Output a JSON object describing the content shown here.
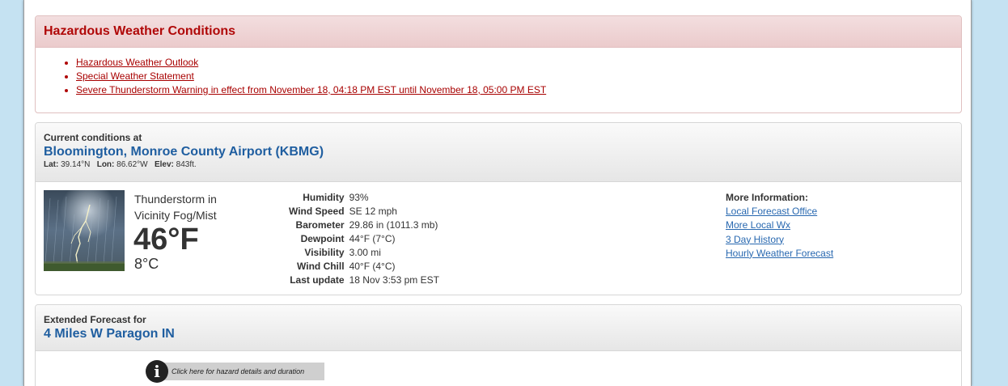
{
  "hazards": {
    "title": "Hazardous Weather Conditions",
    "items": [
      "Hazardous Weather Outlook",
      "Special Weather Statement",
      "Severe Thunderstorm Warning in effect from November 18, 04:18 PM EST until November 18, 05:00 PM EST"
    ]
  },
  "current": {
    "heading": "Current conditions at",
    "location": "Bloomington, Monroe County Airport (KBMG)",
    "lat_label": "Lat:",
    "lat": "39.14°N",
    "lon_label": "Lon:",
    "lon": "86.62°W",
    "elev_label": "Elev:",
    "elev": "843ft.",
    "condition": "Thunderstorm in Vicinity Fog/Mist",
    "temp_f": "46°F",
    "temp_c": "8°C",
    "image_icon": "thunderstorm-lightning-icon",
    "details": [
      {
        "label": "Humidity",
        "value": "93%"
      },
      {
        "label": "Wind Speed",
        "value": "SE 12 mph"
      },
      {
        "label": "Barometer",
        "value": "29.86 in (1011.3 mb)"
      },
      {
        "label": "Dewpoint",
        "value": "44°F (7°C)"
      },
      {
        "label": "Visibility",
        "value": "3.00 mi"
      },
      {
        "label": "Wind Chill",
        "value": "40°F (4°C)"
      },
      {
        "label": "Last update",
        "value": "18 Nov 3:53 pm EST"
      }
    ],
    "more_title": "More Information:",
    "more_links": [
      "Local Forecast Office",
      "More Local Wx",
      "3 Day History",
      "Hourly Weather Forecast"
    ]
  },
  "extended": {
    "heading": "Extended Forecast for",
    "location": "4 Miles W Paragon IN",
    "hazard_link": "Click here for hazard details and duration",
    "info_icon": "info-icon"
  },
  "colors": {
    "background": "#c5e2f2",
    "hazard_red": "#b00808",
    "link_blue": "#2868b0",
    "location_blue": "#1f5ea0"
  }
}
